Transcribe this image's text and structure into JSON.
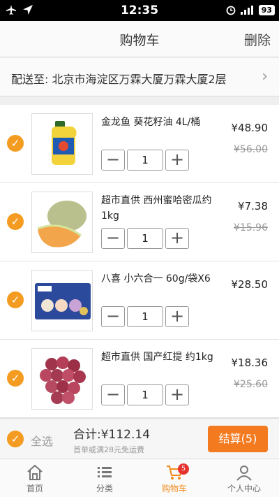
{
  "status_bar": {
    "time": "12:35",
    "battery": "93"
  },
  "nav": {
    "title": "购物车",
    "delete_label": "删除"
  },
  "address": {
    "label": "配送至:",
    "value": "北京市海淀区万霖大厦万霖大厦2层"
  },
  "items": [
    {
      "name": "金龙鱼 葵花籽油 4L/桶",
      "price": "¥48.90",
      "old_price": "¥56.00",
      "qty": "1"
    },
    {
      "name": "超市直供 西州蜜哈密瓜约1kg",
      "price": "¥7.38",
      "old_price": "¥15.96",
      "qty": "1"
    },
    {
      "name": "八喜 小六合一 60g/袋X6",
      "price": "¥28.50",
      "old_price": "",
      "qty": "1"
    },
    {
      "name": "超市直供 国产红提 约1kg",
      "price": "¥18.36",
      "old_price": "¥25.60",
      "qty": "1"
    }
  ],
  "checkout": {
    "select_all": "全选",
    "total": "合计:¥112.14",
    "ship_note": "首单或满28元免运费",
    "pay_label": "结算(5)"
  },
  "tabs": [
    {
      "label": "首页",
      "icon": "home-icon"
    },
    {
      "label": "分类",
      "icon": "category-list-icon"
    },
    {
      "label": "购物车",
      "icon": "cart-icon",
      "badge": "5",
      "active": true
    },
    {
      "label": "个人中心",
      "icon": "user-icon"
    }
  ],
  "colors": {
    "accent": "#f39c21",
    "pay": "#f47a20",
    "badge": "#e5322d",
    "active_tab": "#f08a1c"
  }
}
